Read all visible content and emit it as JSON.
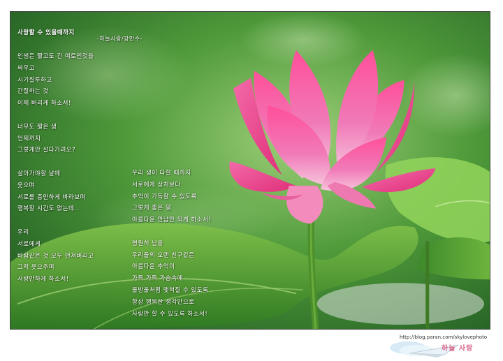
{
  "poem": {
    "title": "사랑할 수 있을때까지",
    "author": "-하늘사랑/강만수-",
    "left_column": [
      "인생은 짧고도 긴 여로인것을",
      "싸우고",
      "시기질투하고",
      "간절하는 것",
      "이제 버리게 하소서!",
      "",
      "너무도 짧은 생",
      "언제까지",
      "그렇게만 살다가려오?",
      "",
      "살아가야할 날에",
      "웃으며",
      "서로를 충만하게 바라보며",
      "행복할 시간도 없는데..",
      "",
      "우리",
      "서로에게",
      "바람같은 것 모두 던져버리고",
      "그저 웃으주며",
      "사랑만하게 하소서!"
    ],
    "right_column": [
      "우리 생이 다할 때까지",
      "서로에게 상처보다",
      "추억이 가득할 수 있도록",
      "그렇게 좋은 말",
      "아름다운 만남만 되게 하소서!",
      "",
      "영원히 남을",
      "우리들의 오랜 친구같은",
      "아름다운 추억이",
      "가득 가득 가슴속에",
      "물방울처럼 맺혀질 수 있도록",
      "항상 행복한 생각만으로",
      "사랑만 할 수 있도록 하소서!"
    ]
  },
  "footer": {
    "url": "http://blog.paran.com/skylovephoto",
    "logo_text": "하늘 사랑"
  }
}
